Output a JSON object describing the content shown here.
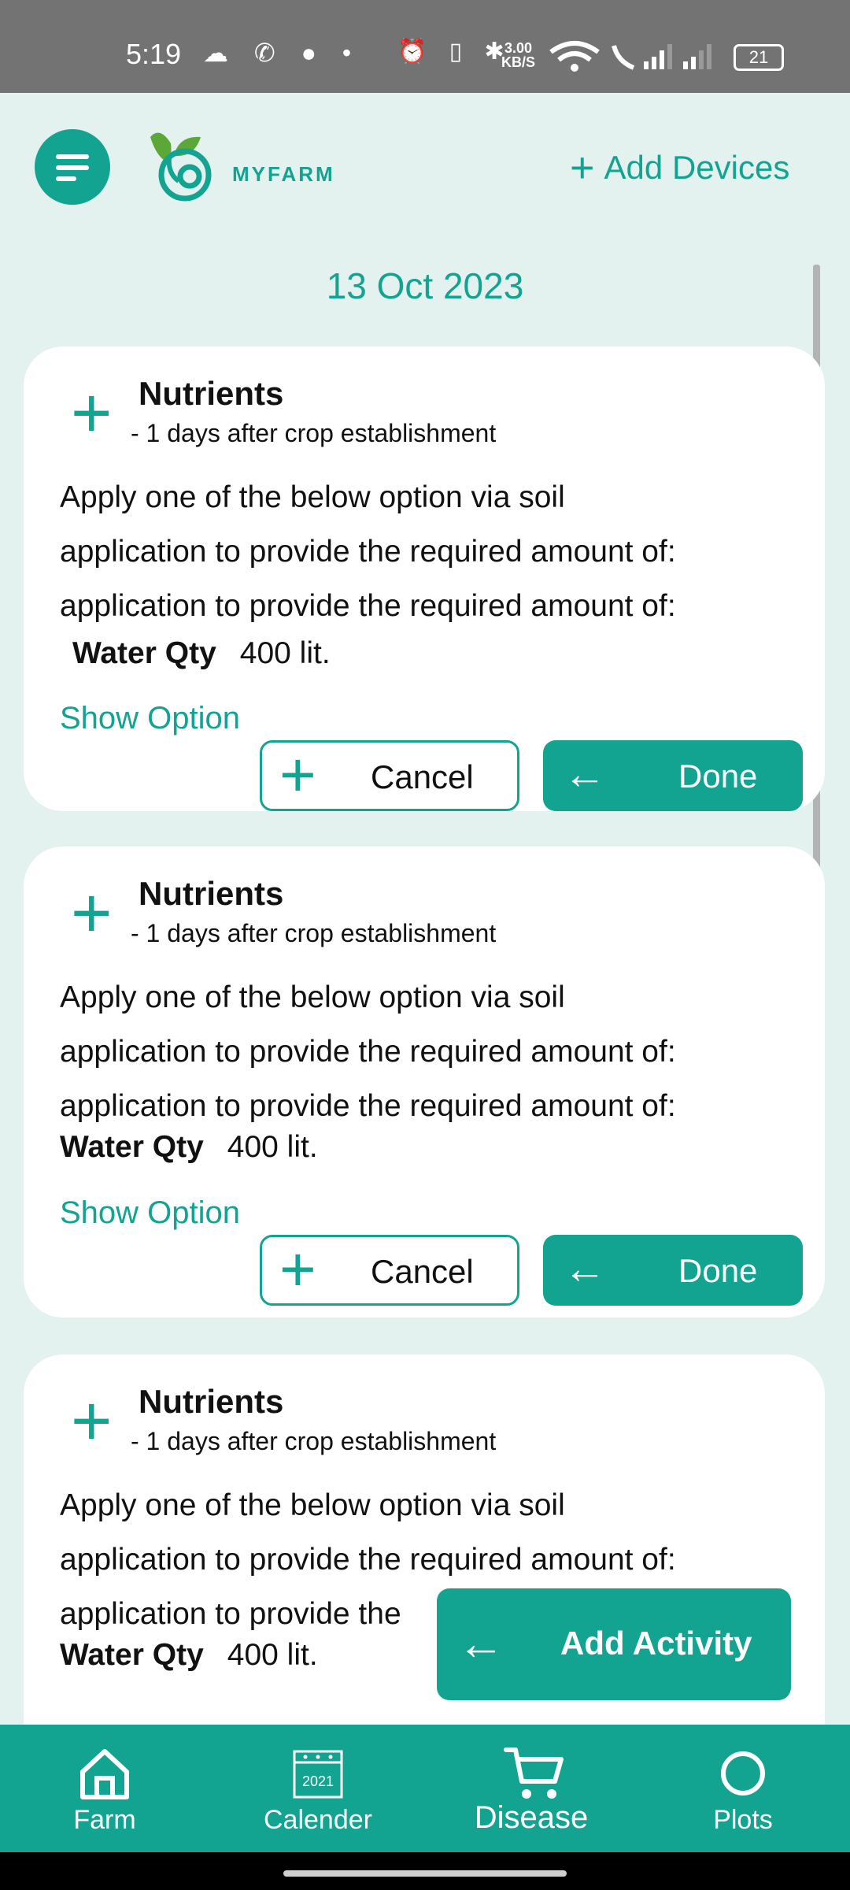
{
  "status_bar": {
    "time": "5:19",
    "left_icons": "☁ ✆ ● •",
    "speed_value": "3.00",
    "speed_unit": "KB/S",
    "battery": "21"
  },
  "header": {
    "logo_text": "MYFARM",
    "add_devices_label": "Add Devices"
  },
  "date": "13 Oct 2023",
  "cards": [
    {
      "title": "Nutrients",
      "subtitle": "- 1 days after crop establishment",
      "lines": [
        "Apply one of the below option via soil",
        "application to provide the required amount of:",
        "application to provide the required amount of:"
      ],
      "water_label": "Water Qty",
      "water_value": "400 lit.",
      "show_option": "Show Option",
      "cancel_label": "Cancel",
      "done_label": "Done"
    },
    {
      "title": "Nutrients",
      "subtitle": "- 1 days after crop establishment",
      "lines": [
        "Apply one of the below option via soil",
        "application to provide the required amount of:",
        "application to provide the required amount of:"
      ],
      "water_label": "Water Qty",
      "water_value": "400 lit.",
      "show_option": "Show Option",
      "cancel_label": "Cancel",
      "done_label": "Done"
    },
    {
      "title": "Nutrients",
      "subtitle": "- 1 days after crop establishment",
      "lines": [
        "Apply one of the below option via soil",
        "application to provide the required amount of:",
        "application to provide the"
      ],
      "water_label": "Water Qty",
      "water_value": "400 lit."
    }
  ],
  "fab": {
    "label": "Add Activity"
  },
  "bottom_nav": [
    {
      "label": "Farm",
      "icon": "home-icon"
    },
    {
      "label": "Calender",
      "icon": "calendar-icon",
      "icon_text": "2021"
    },
    {
      "label": "Disease",
      "icon": "cart-icon"
    },
    {
      "label": "Plots",
      "icon": "circle-icon"
    }
  ],
  "colors": {
    "accent": "#13a391",
    "background": "#e3f1ef",
    "status_bar": "#737373"
  }
}
